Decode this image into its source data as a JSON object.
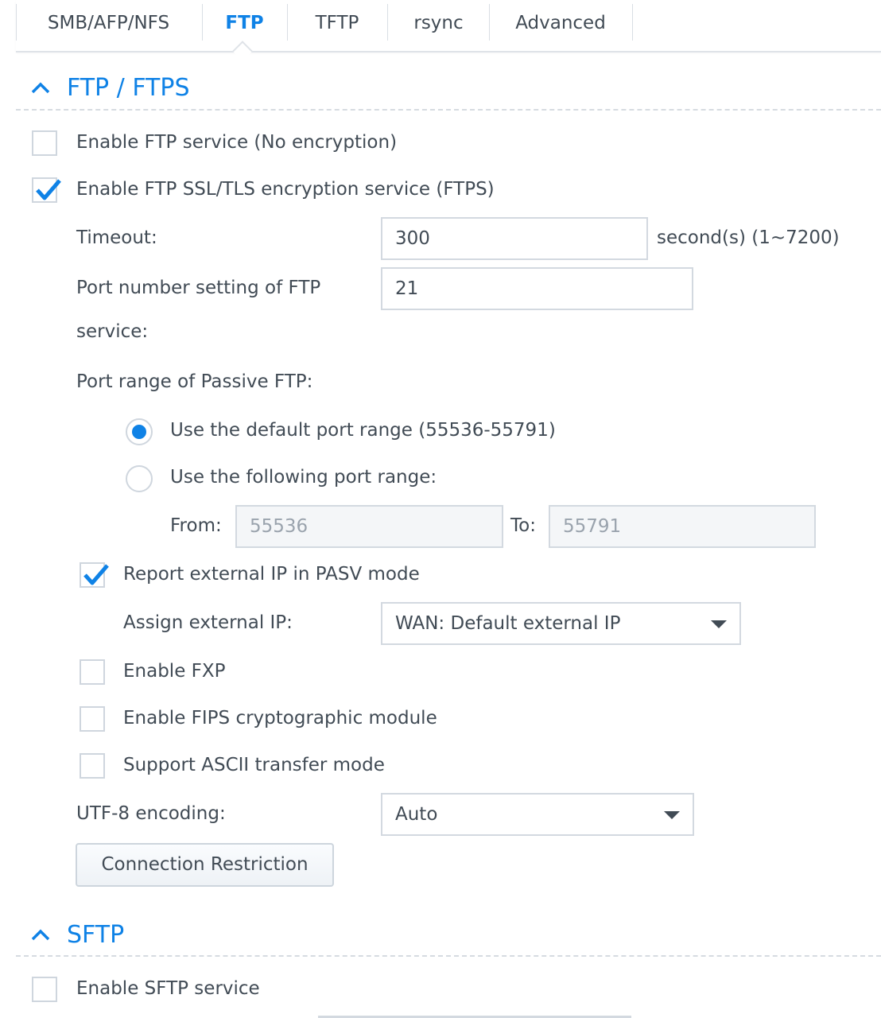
{
  "tabs": [
    {
      "label": "SMB/AFP/NFS",
      "active": false
    },
    {
      "label": "FTP",
      "active": true
    },
    {
      "label": "TFTP",
      "active": false
    },
    {
      "label": "rsync",
      "active": false
    },
    {
      "label": "Advanced",
      "active": false
    }
  ],
  "ftp_section": {
    "title": "FTP / FTPS",
    "collapse_icon": "chevron-up-icon",
    "enable_ftp": {
      "label": "Enable FTP service (No encryption)",
      "checked": false
    },
    "enable_ftps": {
      "label": "Enable FTP SSL/TLS encryption service (FTPS)",
      "checked": true
    },
    "timeout": {
      "label": "Timeout:",
      "value": "300",
      "unit": "second(s) (1~7200)"
    },
    "port": {
      "label_line1": "Port number setting of FTP",
      "label_line2": "service:",
      "value": "21"
    },
    "passive": {
      "label": "Port range of Passive FTP:",
      "options": [
        {
          "label": "Use the default port range (55536-55791)",
          "selected": true
        },
        {
          "label": "Use the following port range:",
          "selected": false
        }
      ],
      "from_label": "From:",
      "from_value": "55536",
      "to_label": "To:",
      "to_value": "55791"
    },
    "report_external_ip": {
      "label": "Report external IP in PASV mode",
      "checked": true
    },
    "assign_external_ip": {
      "label": "Assign external IP:",
      "value": "WAN: Default external IP"
    },
    "enable_fxp": {
      "label": "Enable FXP",
      "checked": false
    },
    "enable_fips": {
      "label": "Enable FIPS cryptographic module",
      "checked": false
    },
    "ascii_mode": {
      "label": "Support ASCII transfer mode",
      "checked": false
    },
    "utf8": {
      "label": "UTF-8 encoding:",
      "value": "Auto"
    },
    "connection_restriction_label": "Connection Restriction"
  },
  "sftp_section": {
    "title": "SFTP",
    "collapse_icon": "chevron-up-icon",
    "enable_sftp": {
      "label": "Enable SFTP service",
      "checked": false
    }
  },
  "colors": {
    "accent": "#0f82e6",
    "text": "#414b55",
    "border": "#d3d9e0",
    "disabled_bg": "#f4f6f8"
  }
}
